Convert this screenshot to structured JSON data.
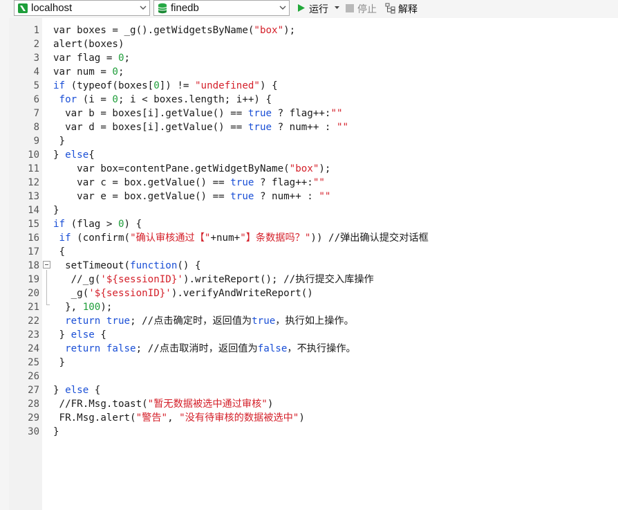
{
  "toolbar": {
    "server_combo": "localhost",
    "db_combo": "finedb",
    "run_label": "运行",
    "stop_label": "停止",
    "explain_label": "解释"
  },
  "editor": {
    "lines": [
      {
        "n": "1",
        "segs": [
          [
            "var boxes = _g().getWidgetsByName(",
            ""
          ],
          [
            "\"box\"",
            "str"
          ],
          [
            ");",
            ""
          ]
        ]
      },
      {
        "n": "2",
        "segs": [
          [
            "alert(boxes)",
            ""
          ]
        ]
      },
      {
        "n": "3",
        "segs": [
          [
            "var flag = ",
            ""
          ],
          [
            "0",
            "num"
          ],
          [
            ";",
            ""
          ]
        ]
      },
      {
        "n": "4",
        "segs": [
          [
            "var num = ",
            ""
          ],
          [
            "0",
            "num"
          ],
          [
            ";",
            ""
          ]
        ]
      },
      {
        "n": "5",
        "segs": [
          [
            "if",
            "kw"
          ],
          [
            " (typeof(boxes[",
            ""
          ],
          [
            "0",
            "num"
          ],
          [
            "]) != ",
            ""
          ],
          [
            "\"undefined\"",
            "str"
          ],
          [
            ") {",
            ""
          ]
        ]
      },
      {
        "n": "6",
        "segs": [
          [
            " ",
            ""
          ],
          [
            "for",
            "kw"
          ],
          [
            " (i = ",
            ""
          ],
          [
            "0",
            "num"
          ],
          [
            "; i < boxes.length; i++) {",
            ""
          ]
        ]
      },
      {
        "n": "7",
        "segs": [
          [
            "  var b = boxes[i].getValue() == ",
            ""
          ],
          [
            "true",
            "kw"
          ],
          [
            " ? flag++:",
            ""
          ],
          [
            "\"\"",
            "str"
          ]
        ]
      },
      {
        "n": "8",
        "segs": [
          [
            "  var d = boxes[i].getValue() == ",
            ""
          ],
          [
            "true",
            "kw"
          ],
          [
            " ? num++ : ",
            ""
          ],
          [
            "\"\"",
            "str"
          ]
        ]
      },
      {
        "n": "9",
        "segs": [
          [
            " }",
            ""
          ]
        ]
      },
      {
        "n": "10",
        "segs": [
          [
            "} ",
            ""
          ],
          [
            "else",
            "kw"
          ],
          [
            "{",
            ""
          ]
        ]
      },
      {
        "n": "11",
        "segs": [
          [
            "    var box=contentPane.getWidgetByName(",
            ""
          ],
          [
            "\"box\"",
            "str"
          ],
          [
            ");",
            ""
          ]
        ]
      },
      {
        "n": "12",
        "segs": [
          [
            "    var c = box.getValue() == ",
            ""
          ],
          [
            "true",
            "kw"
          ],
          [
            " ? flag++:",
            ""
          ],
          [
            "\"\"",
            "str"
          ]
        ]
      },
      {
        "n": "13",
        "segs": [
          [
            "    var e = box.getValue() == ",
            ""
          ],
          [
            "true",
            "kw"
          ],
          [
            " ? num++ : ",
            ""
          ],
          [
            "\"\"",
            "str"
          ]
        ]
      },
      {
        "n": "14",
        "segs": [
          [
            "}",
            ""
          ]
        ]
      },
      {
        "n": "15",
        "segs": [
          [
            "if",
            "kw"
          ],
          [
            " (flag > ",
            ""
          ],
          [
            "0",
            "num"
          ],
          [
            ") {",
            ""
          ]
        ]
      },
      {
        "n": "16",
        "segs": [
          [
            " ",
            ""
          ],
          [
            "if",
            "kw"
          ],
          [
            " (confirm(",
            ""
          ],
          [
            "\"确认审核通过【\"",
            "str"
          ],
          [
            "+num+",
            ""
          ],
          [
            "\"】条数据吗？\"",
            "str"
          ],
          [
            ")) //弹出确认提交对话框",
            ""
          ]
        ]
      },
      {
        "n": "17",
        "segs": [
          [
            " {",
            ""
          ]
        ]
      },
      {
        "n": "18",
        "segs": [
          [
            "  setTimeout(",
            ""
          ],
          [
            "function",
            "kw"
          ],
          [
            "() {",
            ""
          ]
        ]
      },
      {
        "n": "19",
        "segs": [
          [
            "   //_g(",
            ""
          ],
          [
            "'${sessionID}'",
            "str"
          ],
          [
            ").writeReport(); //执行提交入库操作",
            ""
          ]
        ]
      },
      {
        "n": "20",
        "segs": [
          [
            "   _g(",
            ""
          ],
          [
            "'${sessionID}'",
            "str"
          ],
          [
            ").verifyAndWriteReport()",
            ""
          ]
        ]
      },
      {
        "n": "21",
        "segs": [
          [
            "  }, ",
            ""
          ],
          [
            "100",
            "num"
          ],
          [
            ");",
            ""
          ]
        ]
      },
      {
        "n": "22",
        "segs": [
          [
            "  ",
            ""
          ],
          [
            "return",
            "kw"
          ],
          [
            " ",
            ""
          ],
          [
            "true",
            "kw"
          ],
          [
            "; //点击确定时，返回值为",
            ""
          ],
          [
            "true",
            "kw"
          ],
          [
            "，执行如上操作。",
            ""
          ]
        ]
      },
      {
        "n": "23",
        "segs": [
          [
            " } ",
            ""
          ],
          [
            "else",
            "kw"
          ],
          [
            " {",
            ""
          ]
        ]
      },
      {
        "n": "24",
        "segs": [
          [
            "  ",
            ""
          ],
          [
            "return",
            "kw"
          ],
          [
            " ",
            ""
          ],
          [
            "false",
            "kw"
          ],
          [
            "; //点击取消时，返回值为",
            ""
          ],
          [
            "false",
            "kw"
          ],
          [
            "，不执行操作。",
            ""
          ]
        ]
      },
      {
        "n": "25",
        "segs": [
          [
            " }",
            ""
          ]
        ]
      },
      {
        "n": "26",
        "segs": []
      },
      {
        "n": "27",
        "segs": [
          [
            "} ",
            ""
          ],
          [
            "else",
            "kw"
          ],
          [
            " {",
            ""
          ]
        ]
      },
      {
        "n": "28",
        "segs": [
          [
            " //FR.Msg.toast(",
            ""
          ],
          [
            "\"暂无数据被选中通过审核\"",
            "str"
          ],
          [
            ")",
            ""
          ]
        ]
      },
      {
        "n": "29",
        "segs": [
          [
            " FR.Msg.alert(",
            ""
          ],
          [
            "\"警告\"",
            "str"
          ],
          [
            ", ",
            ""
          ],
          [
            "\"没有待审核的数据被选中\"",
            "str"
          ],
          [
            ")",
            ""
          ]
        ]
      },
      {
        "n": "30",
        "segs": [
          [
            "}",
            ""
          ]
        ]
      }
    ]
  }
}
